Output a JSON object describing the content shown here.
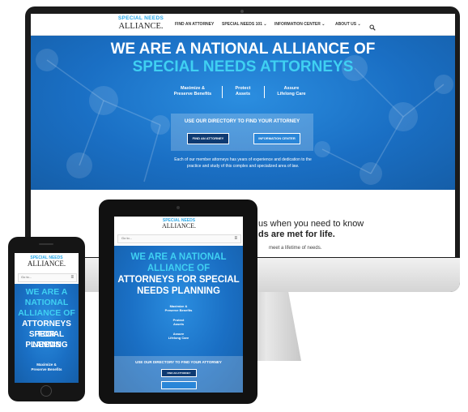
{
  "desktop": {
    "logo_line1": "SPECIAL NEEDS",
    "logo_line2": "ALLIANCE.",
    "nav": [
      "FIND AN ATTORNEY",
      "SPECIAL NEEDS 101 ⌄",
      "INFORMATION CENTER ⌄",
      "ABOUT US ⌄"
    ],
    "search_icon": "search-icon",
    "hero_line1": "WE ARE A NATIONAL ALLIANCE OF",
    "hero_line2": "SPECIAL NEEDS ATTORNEYS",
    "benefits": [
      "Maximize &",
      "Preserve Benefits",
      "Protect",
      "Assets",
      "Assure",
      "Lifelong Care"
    ],
    "directory_title": "USE OUR DIRECTORY TO FIND YOUR ATTORNEY",
    "btn_find": "FIND AN ATTORNEY",
    "btn_info": "INFORMATION CENTER",
    "desc1": "Each of our member attorneys has years of experience and dedication to the",
    "desc2": "practice and study of this complex and specialized area of law.",
    "below1": "us when you need to know",
    "below2": "ds are met for life.",
    "below3": "meet a lifetime of needs."
  },
  "tablet": {
    "logo_line1": "SPECIAL NEEDS",
    "logo_line2": "ALLIANCE.",
    "goto": "Go to...",
    "hero_line1": "WE ARE A NATIONAL",
    "hero_line2": "ALLIANCE OF",
    "hero_line3": "ATTORNEYS FOR SPECIAL",
    "hero_line4": "NEEDS PLANNING",
    "benefits": [
      "Maximize &",
      "Preserve Benefits",
      "Protect",
      "Assets",
      "Assure",
      "Lifelong Care"
    ],
    "directory_title": "USE OUR DIRECTORY TO FIND YOUR ATTORNEY",
    "btn_find": "FIND AN ATTORNEY"
  },
  "phone": {
    "logo_line1": "SPECIAL NEEDS",
    "logo_line2": "ALLIANCE.",
    "goto": "Go to...",
    "hero_line1": "WE ARE A",
    "hero_line2": "NATIONAL",
    "hero_line3": "ALLIANCE OF",
    "hero_line4": "ATTORNEYS FOR",
    "hero_line5": "SPECIAL NEEDS",
    "hero_line6": "PLANNING",
    "benefits": [
      "Maximize &",
      "Preserve Benefits"
    ]
  },
  "colors": {
    "hero_blue": "#1a6fc4",
    "cyan": "#3fd0f2",
    "dark_button": "#0e3a72"
  }
}
